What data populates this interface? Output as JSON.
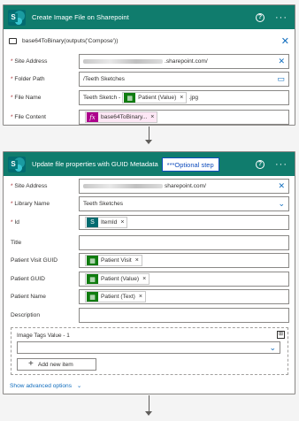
{
  "card1": {
    "title": "Create Image File on Sharepoint",
    "help": "?",
    "more": "···",
    "warning_text": "base64ToBinary(outputs('Compose'))",
    "site_label": "Site Address",
    "site_value": ".sharepoint.com/",
    "folder_label": "Folder Path",
    "folder_value": "/Teeth Sketches",
    "filename_label": "File Name",
    "filename_prefix": "Teeth Sketch -",
    "filename_token": "Patient (Value)",
    "filename_suffix": ".jpg",
    "filecontent_label": "File Content",
    "filecontent_token": "base64ToBinary..."
  },
  "card2": {
    "title": "Update file properties with GUID Metadata",
    "note": "***Optional step",
    "help": "?",
    "more": "···",
    "site_label": "Site Address",
    "site_value": "sharepoint.com/",
    "library_label": "Library Name",
    "library_value": "Teeth Sketches",
    "id_label": "Id",
    "id_token": "ItemId",
    "title_label": "Title",
    "visit_label": "Patient Visit GUID",
    "visit_token": "Patient Visit",
    "guid_label": "Patient GUID",
    "guid_token": "Patient (Value)",
    "name_label": "Patient Name",
    "name_token": "Patient (Text)",
    "desc_label": "Description",
    "tags_label": "Image Tags Value - 1",
    "add_item": "Add new item",
    "advanced": "Show advanced options"
  },
  "required_mark": "*",
  "remove_mark": "×"
}
